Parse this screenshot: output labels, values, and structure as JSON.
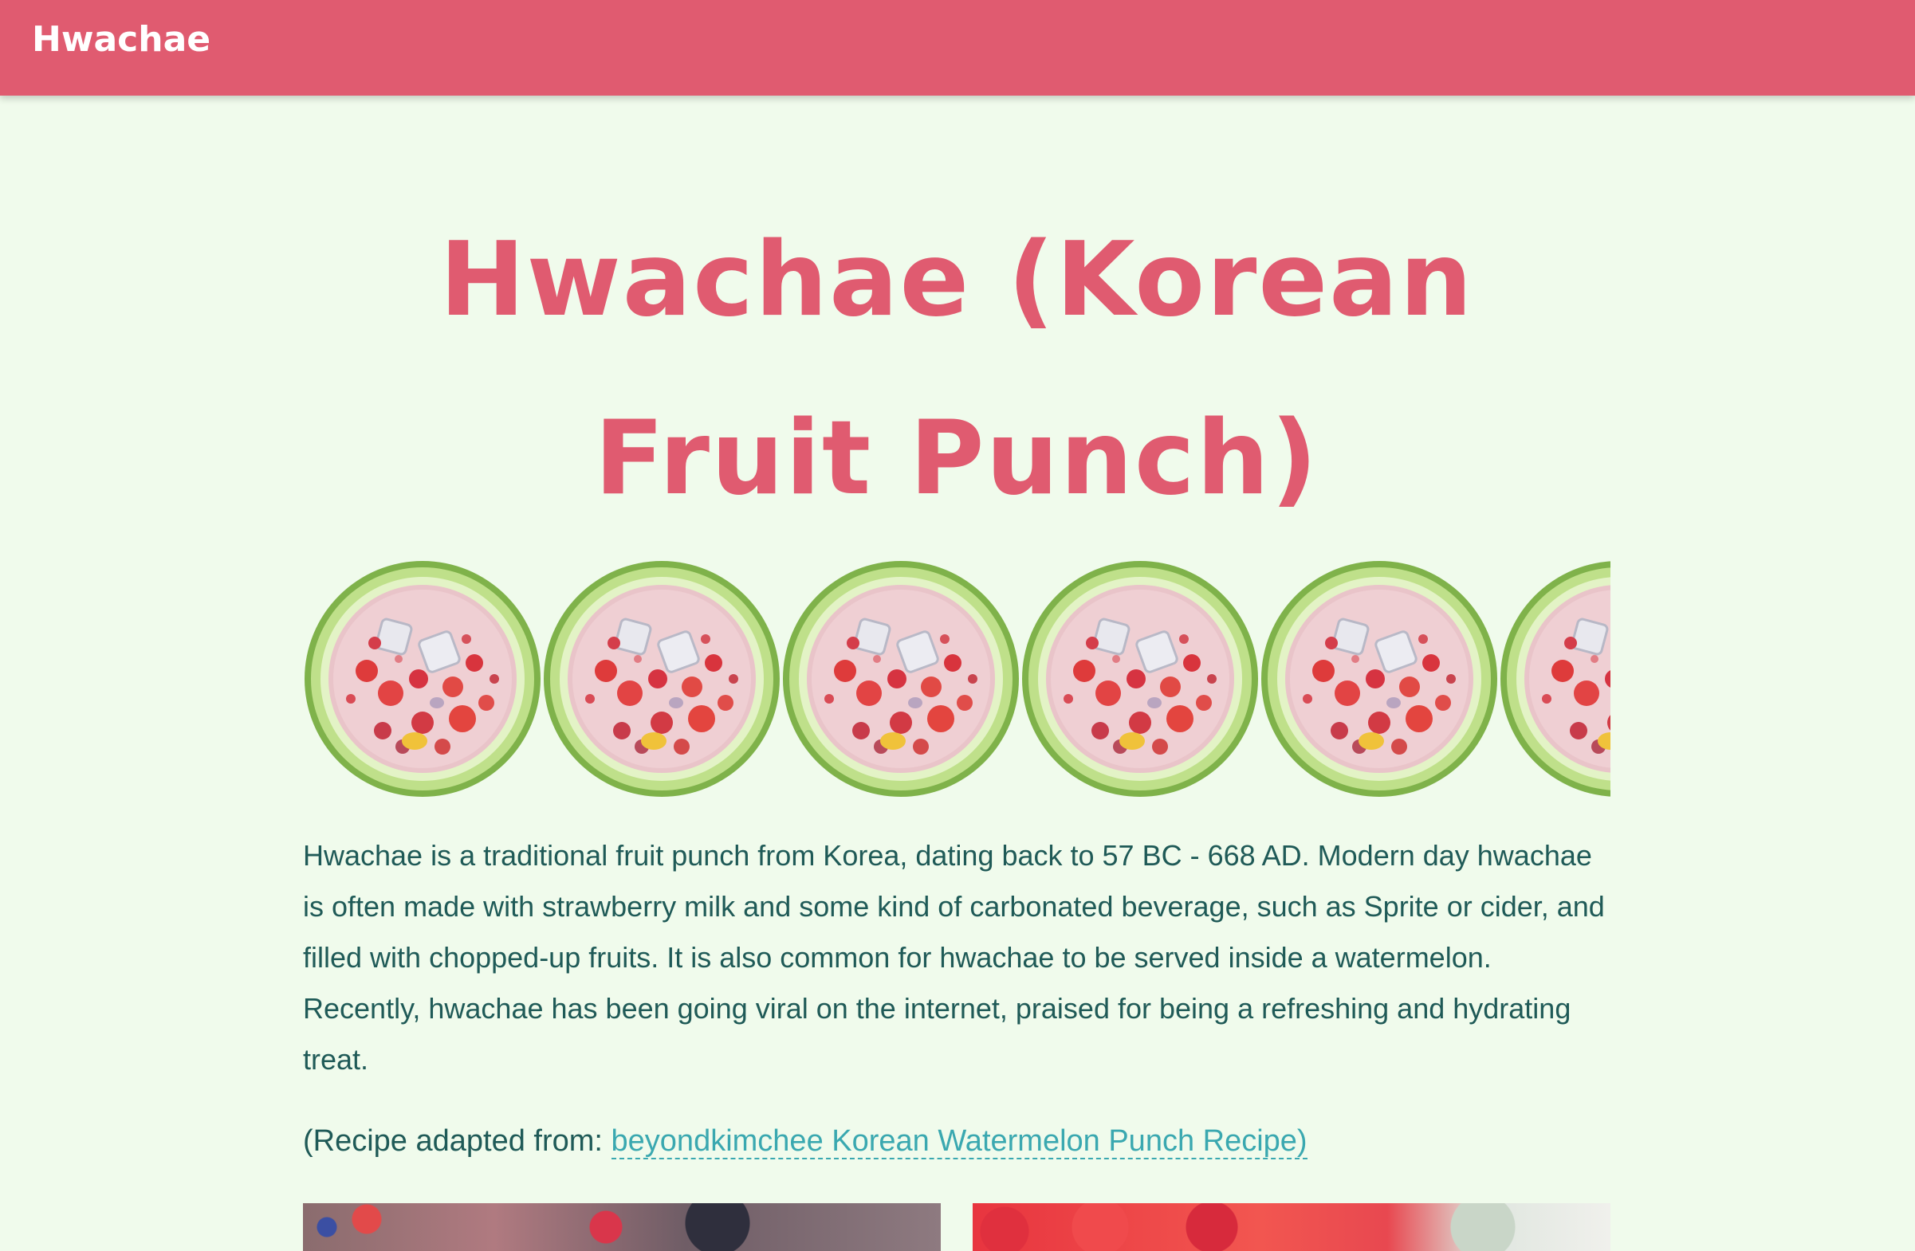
{
  "nav": {
    "brand": "Hwachae"
  },
  "article": {
    "title": "Hwachae (Korean Fruit Punch)",
    "intro": "Hwachae is a traditional fruit punch from Korea, dating back to 57 BC - 668 AD. Modern day hwachae is often made with strawberry milk and some kind of carbonated beverage, such as Sprite or cider, and filled with chopped-up fruits. It is also common for hwachae to be served inside a watermelon. Recently, hwachae has been going viral on the internet, praised for being a refreshing and hydrating treat.",
    "credit_prefix": "(Recipe adapted from: ",
    "credit_link": "beyondkimchee Korean Watermelon Punch Recipe)"
  },
  "colors": {
    "header_bg": "#e05b70",
    "page_bg": "#f0fbec",
    "title": "#e05b70",
    "body_text": "#1f5a57",
    "link": "#3aa8b0"
  }
}
